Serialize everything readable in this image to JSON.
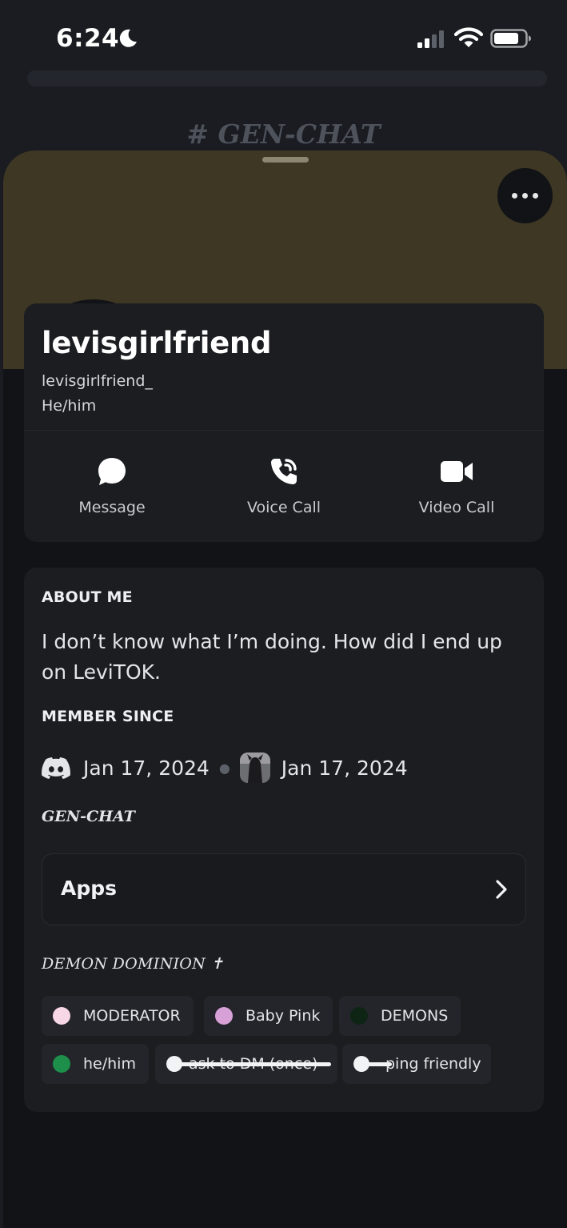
{
  "status_bar": {
    "time": "6:24"
  },
  "behind": {
    "channel_title": "# GEN-CHAT"
  },
  "colors": {
    "banner": "#3e3724",
    "sheet": "#121316",
    "card": "#1c1d21",
    "status_offline": "#8a8e96"
  },
  "profile": {
    "display_name": "levisgirlfriend",
    "username": "levisgirlfriend_",
    "pronouns": "He/him",
    "status": "offline"
  },
  "actions": [
    {
      "label": "Message",
      "icon": "chat-bubble-icon"
    },
    {
      "label": "Voice Call",
      "icon": "phone-call-icon"
    },
    {
      "label": "Video Call",
      "icon": "video-camera-icon"
    }
  ],
  "about": {
    "heading": "ABOUT ME",
    "bio": "I don’t know what I’m doing. How did I end up on LeviTOK."
  },
  "member_since": {
    "heading": "MEMBER SINCE",
    "discord_date": "Jan 17, 2024",
    "server_date": "Jan 17, 2024"
  },
  "server": {
    "name": "GEN-CHAT",
    "apps_label": "Apps",
    "roles_heading": "DEMON DOMINION ✝"
  },
  "roles": [
    {
      "name": "MODERATOR",
      "color": "#f7d6e6"
    },
    {
      "name": "Baby Pink",
      "color": "#d7a0d6"
    },
    {
      "name": "DEMONS",
      "color": "#0e2414"
    },
    {
      "name": "he/him",
      "color": "#1e8f4a"
    },
    {
      "name": "ask to DM (once)",
      "color": "#f2f3f5"
    },
    {
      "name": "ping friendly",
      "color": "#f2f3f5"
    }
  ]
}
